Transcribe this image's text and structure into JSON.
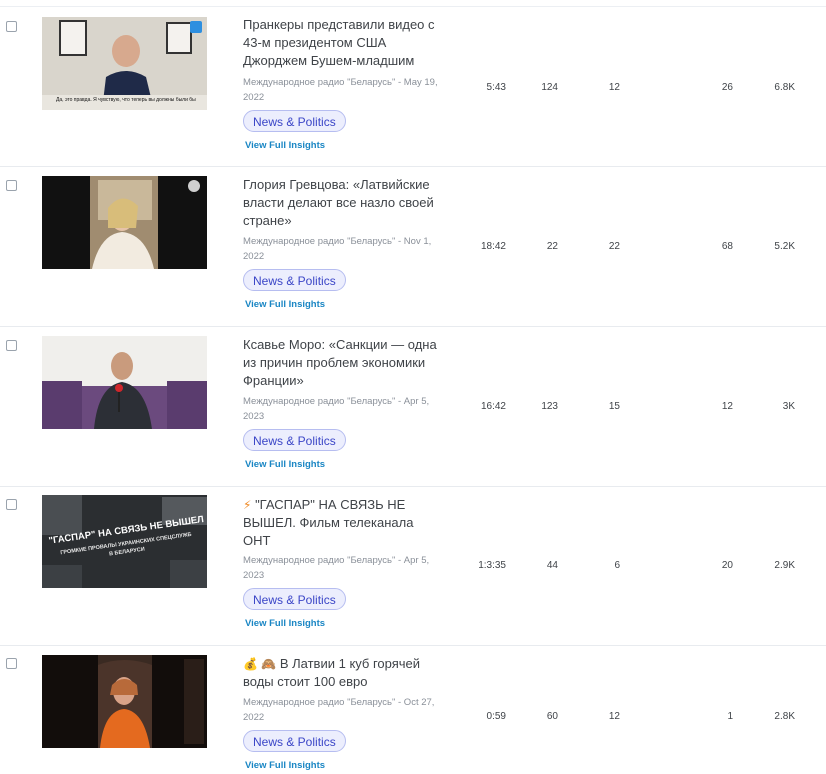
{
  "rows": [
    {
      "title": "Пранкеры представили видео с 43-м президентом США Джорджем Бушем-младшим",
      "meta": "Международное радио \"Беларусь\" - May 19, 2022",
      "tag": "News & Politics",
      "insights": "View Full Insights",
      "duration": "5:43",
      "likes": "124",
      "comments": "12",
      "shares": "26",
      "views": "6.8K",
      "thumb_caption": "Да, это правда. Я чувствую, что теперь вы должны были бы знать..."
    },
    {
      "title": "Глория Гревцова: «Латвийские власти делают все назло своей стране»",
      "meta": "Международное радио \"Беларусь\" - Nov 1, 2022",
      "tag": "News & Politics",
      "insights": "View Full Insights",
      "duration": "18:42",
      "likes": "22",
      "comments": "22",
      "shares": "68",
      "views": "5.2K"
    },
    {
      "title": "Ксавье Моро: «Санкции — одна из причин проблем экономики Франции»",
      "meta": "Международное радио \"Беларусь\" - Apr 5, 2023",
      "tag": "News & Politics",
      "insights": "View Full Insights",
      "duration": "16:42",
      "likes": "123",
      "comments": "15",
      "shares": "12",
      "views": "3K"
    },
    {
      "title_emoji": "⚡",
      "title": "\"ГАСПАР\" НА СВЯЗЬ НЕ ВЫШЕЛ. Фильм телеканала ОНТ",
      "meta": "Международное радио \"Беларусь\" - Apr 5, 2023",
      "tag": "News & Politics",
      "insights": "View Full Insights",
      "duration": "1:3:35",
      "likes": "44",
      "comments": "6",
      "shares": "20",
      "views": "2.9K",
      "thumb_line1": "\"ГАСПАР\" НА СВЯЗЬ НЕ ВЫШЕЛ",
      "thumb_line2": "ГРОМКИЕ ПРОВАЛЫ УКРАИНСКИХ СПЕЦСЛУЖБ",
      "thumb_line3": "В БЕЛАРУСИ"
    },
    {
      "title_emoji": "💰 🙈",
      "title": "В Латвии 1 куб горячей воды стоит 100 евро",
      "meta": "Международное радио \"Беларусь\" - Oct 27, 2022",
      "tag": "News & Politics",
      "insights": "View Full Insights",
      "duration": "0:59",
      "likes": "60",
      "comments": "12",
      "shares": "1",
      "views": "2.8K"
    }
  ],
  "colors": {
    "tag_bg": "#eceefd",
    "tag_text": "#3a45c7",
    "link": "#1a86c4"
  }
}
